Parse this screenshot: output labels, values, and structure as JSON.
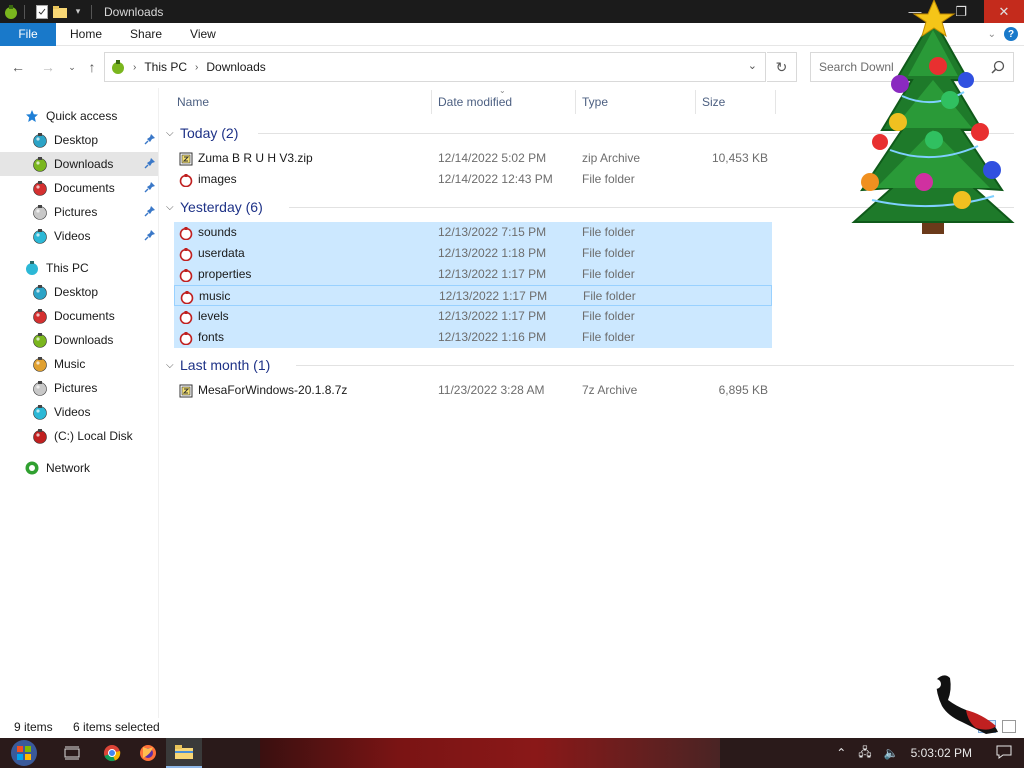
{
  "window": {
    "title": "Downloads",
    "close_icon": "close-icon"
  },
  "ribbon": {
    "tabs": [
      "File",
      "Home",
      "Share",
      "View"
    ]
  },
  "address": {
    "crumbs": [
      "This PC",
      "Downloads"
    ]
  },
  "search": {
    "placeholder": "Search Downl"
  },
  "sidebar": {
    "items": [
      {
        "label": "Quick access",
        "icon": "star-icon",
        "color": "#1e7fd6"
      },
      {
        "label": "Desktop",
        "icon": "desktop-icon",
        "color": "#2ca3c6",
        "pinned": true
      },
      {
        "label": "Downloads",
        "icon": "downloads-icon",
        "color": "#7ab61e",
        "pinned": true,
        "selected": true
      },
      {
        "label": "Documents",
        "icon": "documents-icon",
        "color": "#d43030",
        "pinned": true
      },
      {
        "label": "Pictures",
        "icon": "pictures-icon",
        "color": "#c8c8c8",
        "pinned": true
      },
      {
        "label": "Videos",
        "icon": "videos-icon",
        "color": "#2cb8d6",
        "pinned": true
      },
      {
        "label": "This PC",
        "icon": "this-pc-icon",
        "color": "#2cb8d6"
      },
      {
        "label": "Desktop",
        "icon": "desktop-icon",
        "color": "#2ca3c6"
      },
      {
        "label": "Documents",
        "icon": "documents-icon",
        "color": "#d43030"
      },
      {
        "label": "Downloads",
        "icon": "downloads-icon",
        "color": "#7ab61e"
      },
      {
        "label": "Music",
        "icon": "music-icon",
        "color": "#e0a030"
      },
      {
        "label": "Pictures",
        "icon": "pictures-icon",
        "color": "#c8c8c8"
      },
      {
        "label": "Videos",
        "icon": "videos-icon",
        "color": "#2cb8d6"
      },
      {
        "label": "(C:) Local Disk",
        "icon": "disk-icon",
        "color": "#c02020"
      },
      {
        "label": "Network",
        "icon": "network-icon",
        "color": "#30a030"
      }
    ]
  },
  "columns": [
    "Name",
    "Date modified",
    "Type",
    "Size"
  ],
  "groups": [
    {
      "label": "Today (2)",
      "files": [
        {
          "name": "Zuma B R U H V3.zip",
          "date": "12/14/2022 5:02 PM",
          "type": "zip Archive",
          "size": "10,453 KB",
          "icon": "archive-icon"
        },
        {
          "name": "images",
          "date": "12/14/2022 12:43 PM",
          "type": "File folder",
          "size": "",
          "icon": "folder-icon"
        }
      ]
    },
    {
      "label": "Yesterday (6)",
      "files": [
        {
          "name": "sounds",
          "date": "12/13/2022 7:15 PM",
          "type": "File folder",
          "size": "",
          "icon": "folder-icon",
          "selected": true
        },
        {
          "name": "userdata",
          "date": "12/13/2022 1:18 PM",
          "type": "File folder",
          "size": "",
          "icon": "folder-icon",
          "selected": true
        },
        {
          "name": "properties",
          "date": "12/13/2022 1:17 PM",
          "type": "File folder",
          "size": "",
          "icon": "folder-icon",
          "selected": true
        },
        {
          "name": "music",
          "date": "12/13/2022 1:17 PM",
          "type": "File folder",
          "size": "",
          "icon": "folder-icon",
          "selected": true,
          "focused": true
        },
        {
          "name": "levels",
          "date": "12/13/2022 1:17 PM",
          "type": "File folder",
          "size": "",
          "icon": "folder-icon",
          "selected": true
        },
        {
          "name": "fonts",
          "date": "12/13/2022 1:16 PM",
          "type": "File folder",
          "size": "",
          "icon": "folder-icon",
          "selected": true
        }
      ]
    },
    {
      "label": "Last month (1)",
      "files": [
        {
          "name": "MesaForWindows-20.1.8.7z",
          "date": "11/23/2022 3:28 AM",
          "type": "7z Archive",
          "size": "6,895 KB",
          "icon": "archive-icon"
        }
      ]
    }
  ],
  "status": {
    "count": "9 items",
    "selected": "6 items selected"
  },
  "taskbar": {
    "clock": "5:03:02 PM"
  },
  "colors": {
    "accent": "#1979ca",
    "selection": "#cce8ff",
    "group_text": "#1e3287"
  }
}
